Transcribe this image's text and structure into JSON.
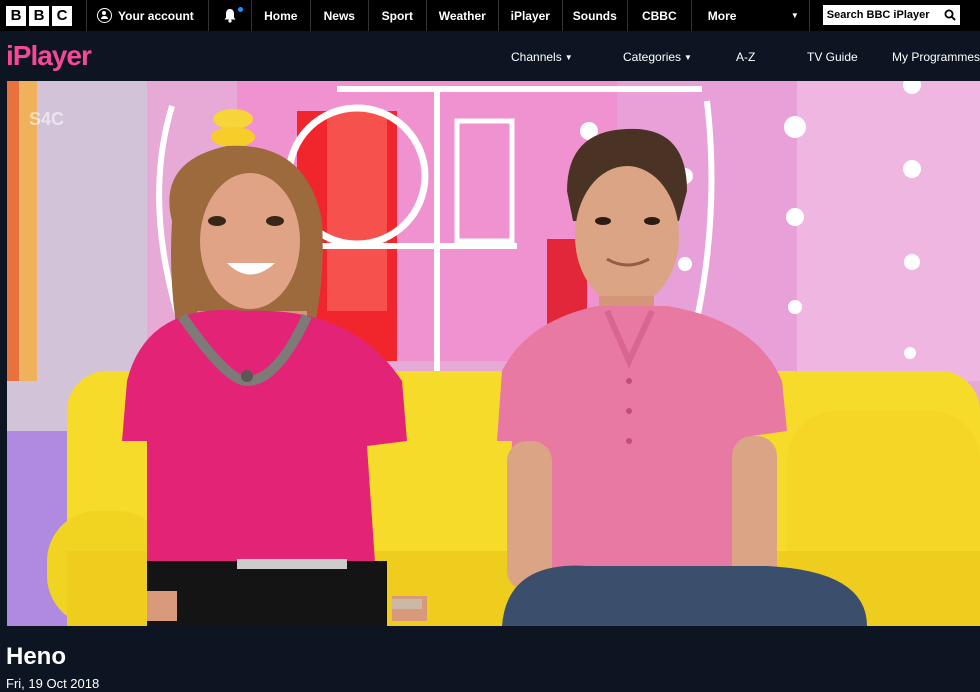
{
  "global_nav": {
    "logo_letters": [
      "B",
      "B",
      "C"
    ],
    "account_label": "Your account",
    "items": [
      "Home",
      "News",
      "Sport",
      "Weather",
      "iPlayer",
      "Sounds",
      "CBBC"
    ],
    "more_label": "More",
    "search_placeholder": "Search BBC iPlayer"
  },
  "iplayer_nav": {
    "logo": "iPlayer",
    "channels_label": "Channels",
    "categories_label": "Categories",
    "az_label": "A-Z",
    "tv_guide_label": "TV Guide",
    "my_programmes_label": "My Programmes"
  },
  "video": {
    "channel_watermark": "S4C"
  },
  "programme": {
    "title": "Heno",
    "date": "Fri, 19 Oct 2018"
  },
  "colors": {
    "brand_pink": "#f54996",
    "background": "#0d1522",
    "notification_dot": "#1e90ff"
  }
}
